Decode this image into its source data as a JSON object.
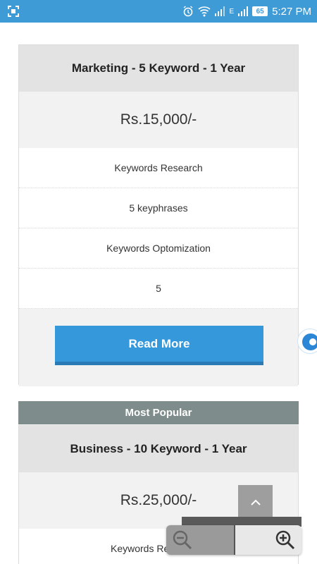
{
  "status_bar": {
    "battery": "65",
    "time": "5:27 PM",
    "network": "E"
  },
  "plan1": {
    "title": "Marketing - 5 Keyword - 1 Year",
    "price": "Rs.15,000/-",
    "features": [
      "Keywords Research",
      "5 keyphrases",
      "Keywords Optomization",
      "5"
    ],
    "button": "Read More"
  },
  "popular_label": "Most Popular",
  "plan2": {
    "title": "Business - 10 Keyword - 1 Year",
    "price": "Rs.25,000/-",
    "features": [
      "Keywords Re"
    ]
  },
  "colors": {
    "status_bar": "#3E9BD6",
    "button": "#3598DB",
    "popular_bg": "#7f8c8c"
  },
  "icons": [
    "screenshot-icon",
    "alarm-icon",
    "wifi-icon",
    "signal-icon",
    "battery-icon",
    "chevron-up-icon",
    "zoom-out-icon",
    "zoom-in-icon",
    "chat-widget-icon"
  ]
}
